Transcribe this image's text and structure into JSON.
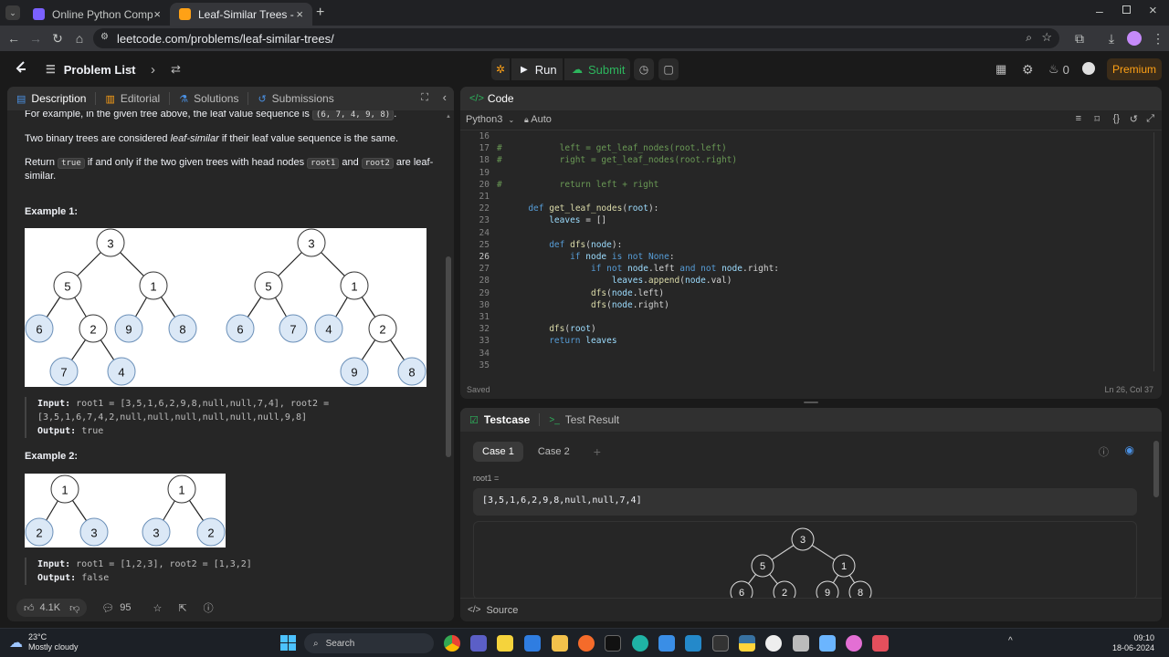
{
  "browser": {
    "tabs": [
      {
        "title": "Online Python Compiler - onlin",
        "active": false
      },
      {
        "title": "Leaf-Similar Trees - LeetCode",
        "active": true
      }
    ],
    "url": "leetcode.com/problems/leaf-similar-trees/"
  },
  "header": {
    "problem_list": "Problem List",
    "run": "Run",
    "submit": "Submit",
    "streak_count": "0",
    "premium": "Premium"
  },
  "description_panel": {
    "tabs": [
      "Description",
      "Editorial",
      "Solutions",
      "Submissions"
    ],
    "para1_prefix": "For example, in the given tree above, the leaf value sequence is",
    "para1_code": "(6, 7, 4, 9, 8)",
    "para1_suffix": ".",
    "para2_prefix": "Two binary trees are considered",
    "para2_em": "leaf-similar",
    "para2_suffix": "if their leaf value sequence is the same.",
    "para3_a": "Return",
    "para3_code1": "true",
    "para3_b": "if and only if the two given trees with head nodes",
    "para3_code2": "root1",
    "para3_c": "and",
    "para3_code3": "root2",
    "para3_d": "are leaf-similar.",
    "example1_title": "Example 1:",
    "example1_input_label": "Input:",
    "example1_input_line1": "root1 = [3,5,1,6,2,9,8,null,null,7,4], root2 =",
    "example1_input_line2": "[3,5,1,6,7,4,2,null,null,null,null,null,null,9,8]",
    "example1_output_label": "Output:",
    "example1_output": "true",
    "example2_title": "Example 2:",
    "example2_input_label": "Input:",
    "example2_input": "root1 = [1,2,3], root2 = [1,3,2]",
    "example2_output_label": "Output:",
    "example2_output": "false",
    "trees1": {
      "left_labels": [
        "3",
        "5",
        "1",
        "6",
        "2",
        "9",
        "8",
        "7",
        "4"
      ],
      "right_labels": [
        "3",
        "5",
        "1",
        "6",
        "7",
        "4",
        "2",
        "9",
        "8"
      ]
    },
    "trees2": {
      "left_labels": [
        "1",
        "2",
        "3"
      ],
      "right_labels": [
        "1",
        "3",
        "2"
      ]
    },
    "likes": "4.1K",
    "comments": "95"
  },
  "code_panel": {
    "title": "Code",
    "language": "Python3",
    "auto": "Auto",
    "status": "Saved",
    "cursor": "Ln 26, Col 37",
    "lines": [
      {
        "n": "16",
        "t": ""
      },
      {
        "n": "17",
        "t": "#           left = get_leaf_nodes(root.left)"
      },
      {
        "n": "18",
        "t": "#           right = get_leaf_nodes(root.right)"
      },
      {
        "n": "19",
        "t": ""
      },
      {
        "n": "20",
        "t": "#           return left + right"
      },
      {
        "n": "21",
        "t": ""
      },
      {
        "n": "22",
        "t": "      def get_leaf_nodes(root):"
      },
      {
        "n": "23",
        "t": "          leaves = []"
      },
      {
        "n": "24",
        "t": ""
      },
      {
        "n": "25",
        "t": "          def dfs(node):"
      },
      {
        "n": "26",
        "t": "              if node is not None:"
      },
      {
        "n": "27",
        "t": "                  if not node.left and not node.right:"
      },
      {
        "n": "28",
        "t": "                      leaves.append(node.val)"
      },
      {
        "n": "29",
        "t": "                  dfs(node.left)"
      },
      {
        "n": "30",
        "t": "                  dfs(node.right)"
      },
      {
        "n": "31",
        "t": ""
      },
      {
        "n": "32",
        "t": "          dfs(root)"
      },
      {
        "n": "33",
        "t": "          return leaves"
      },
      {
        "n": "34",
        "t": ""
      },
      {
        "n": "35",
        "t": ""
      }
    ]
  },
  "testcase_panel": {
    "tab_testcase": "Testcase",
    "tab_result": "Test Result",
    "case1": "Case 1",
    "case2": "Case 2",
    "add": "+",
    "param_label": "root1 =",
    "param_value": "[3,5,1,6,2,9,8,null,null,7,4]",
    "tree_labels": [
      "3",
      "5",
      "1",
      "6",
      "2",
      "9",
      "8"
    ],
    "source": "Source"
  },
  "taskbar": {
    "weather_temp": "23°C",
    "weather_desc": "Mostly cloudy",
    "search": "Search",
    "time": "09:10",
    "date": "18-06-2024"
  }
}
